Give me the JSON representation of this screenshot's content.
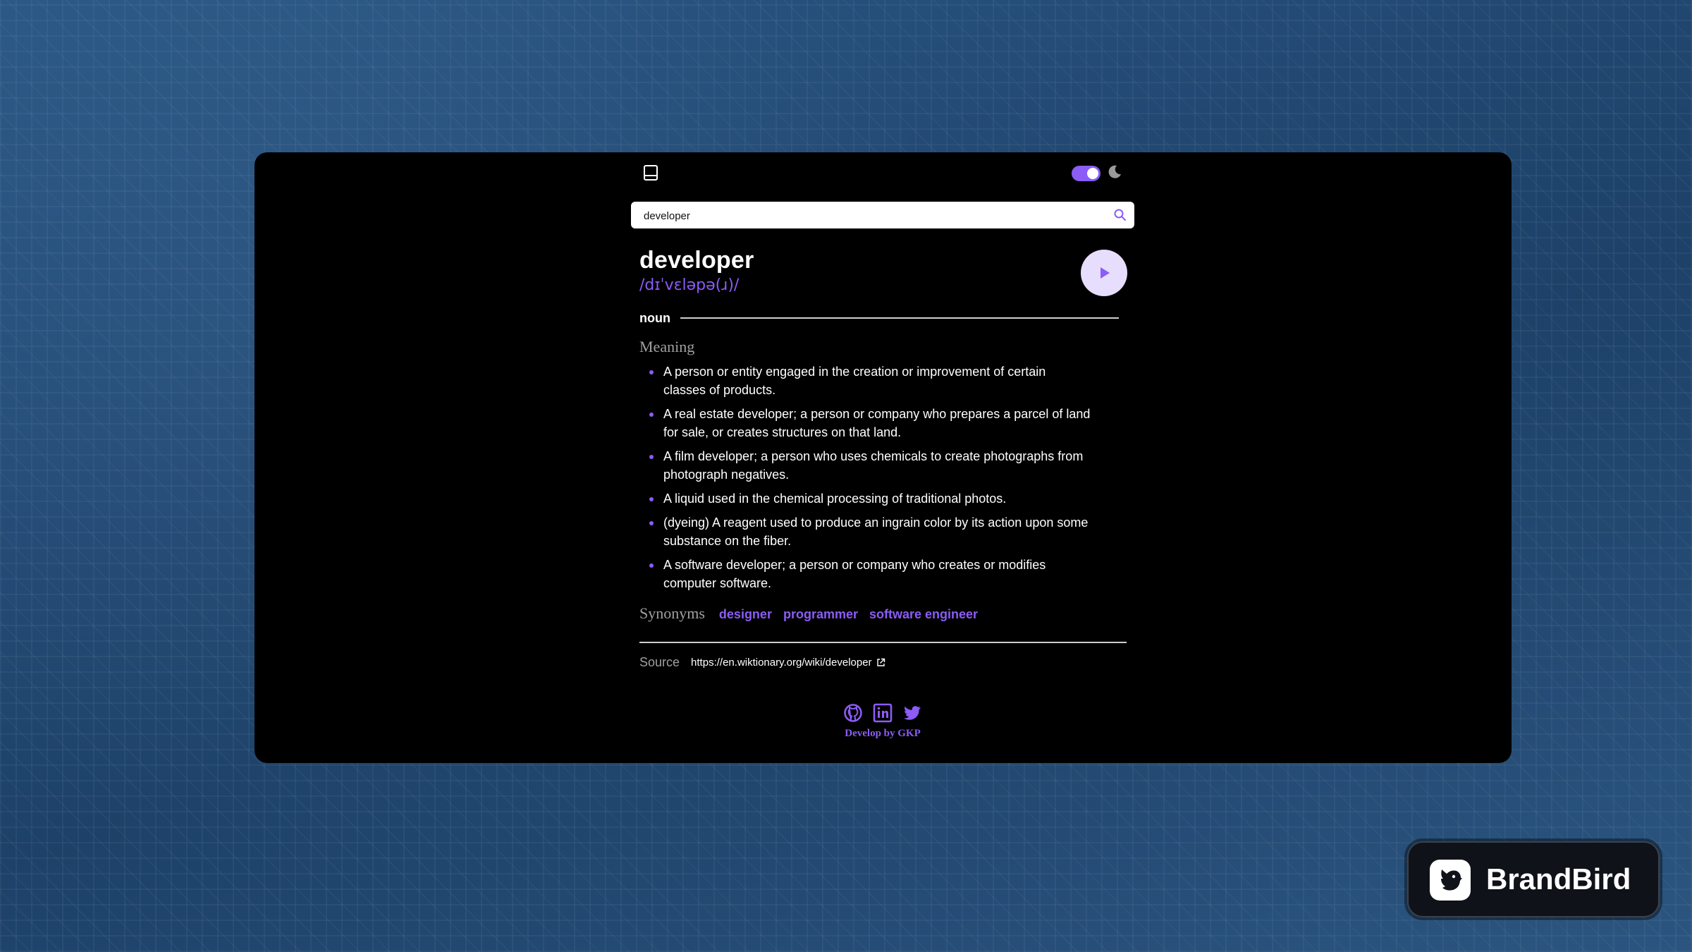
{
  "search": {
    "value": "developer"
  },
  "entry": {
    "word": "developer",
    "phonetic": "/dɪˈvɛləpə(ɹ)/",
    "part_of_speech": "noun",
    "meaning_heading": "Meaning",
    "definitions": [
      "A person or entity engaged in the creation or improvement of certain classes of products.",
      "A real estate developer; a person or company who prepares a parcel of land for sale, or creates structures on that land.",
      "A film developer; a person who uses chemicals to create photographs from photograph negatives.",
      "A liquid used in the chemical processing of traditional photos.",
      "(dyeing) A reagent used to produce an ingrain color by its action upon some substance on the fiber.",
      "A software developer; a person or company who creates or modifies computer software."
    ],
    "synonyms_heading": "Synonyms",
    "synonyms": [
      "designer",
      "programmer",
      "software engineer"
    ],
    "source_heading": "Source",
    "source_url": "https://en.wiktionary.org/wiki/developer"
  },
  "footer": {
    "credit": "Develop by GKP"
  },
  "badge": {
    "text": "BrandBird"
  },
  "icons": {
    "logo": "book-icon",
    "theme": "moon-icon",
    "search": "search-icon",
    "play": "play-icon",
    "external": "external-link-icon",
    "social": [
      "github-icon",
      "linkedin-icon",
      "twitter-icon"
    ]
  },
  "colors": {
    "accent": "#8b5cf6",
    "play_bg": "#e7defd",
    "app_bg": "#000000",
    "muted": "#a0a0a0"
  },
  "theme_toggle": {
    "dark_mode_on": true
  }
}
